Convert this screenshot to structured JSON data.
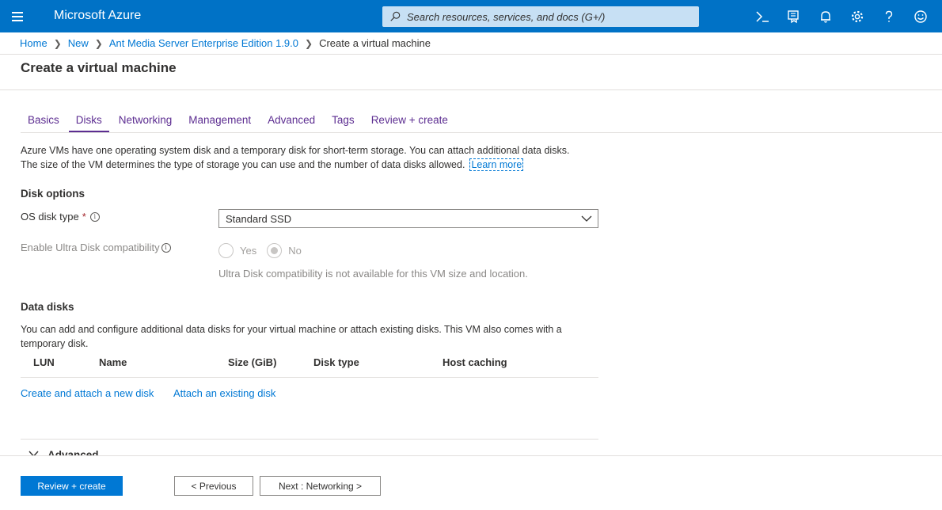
{
  "topbar": {
    "brand": "Microsoft Azure",
    "search_placeholder": "Search resources, services, and docs (G+/)",
    "icons": [
      "cloud-shell-icon",
      "directory-filter-icon",
      "notifications-icon",
      "settings-icon",
      "help-icon",
      "feedback-icon"
    ]
  },
  "breadcrumb": {
    "items": [
      "Home",
      "New",
      "Ant Media Server Enterprise Edition 1.9.0"
    ],
    "current": "Create a virtual machine"
  },
  "page": {
    "title": "Create a virtual machine"
  },
  "tabs": [
    {
      "label": "Basics"
    },
    {
      "label": "Disks"
    },
    {
      "label": "Networking"
    },
    {
      "label": "Management"
    },
    {
      "label": "Advanced"
    },
    {
      "label": "Tags"
    },
    {
      "label": "Review + create"
    }
  ],
  "intro": {
    "line1": "Azure VMs have one operating system disk and a temporary disk for short-term storage. You can attach additional data disks.",
    "line2": "The size of the VM determines the type of storage you can use and the number of data disks allowed.",
    "learn_more": "Learn more"
  },
  "disk_options": {
    "title": "Disk options",
    "os_disk_label": "OS disk type",
    "required_mark": "*",
    "os_disk_value": "Standard SSD",
    "ultra_label": "Enable Ultra Disk compatibility",
    "radio_yes": "Yes",
    "radio_no": "No",
    "ultra_hint": "Ultra Disk compatibility is not available for this VM size and location."
  },
  "data_disks": {
    "title": "Data disks",
    "description": "You can add and configure additional data disks for your virtual machine or attach existing disks. This VM also comes with a temporary disk.",
    "columns": [
      "LUN",
      "Name",
      "Size (GiB)",
      "Disk type",
      "Host caching"
    ],
    "create_link": "Create and attach a new disk",
    "attach_link": "Attach an existing disk"
  },
  "advanced": {
    "label": "Advanced"
  },
  "footer": {
    "review_create": "Review + create",
    "previous": "< Previous",
    "next": "Next : Networking >"
  }
}
